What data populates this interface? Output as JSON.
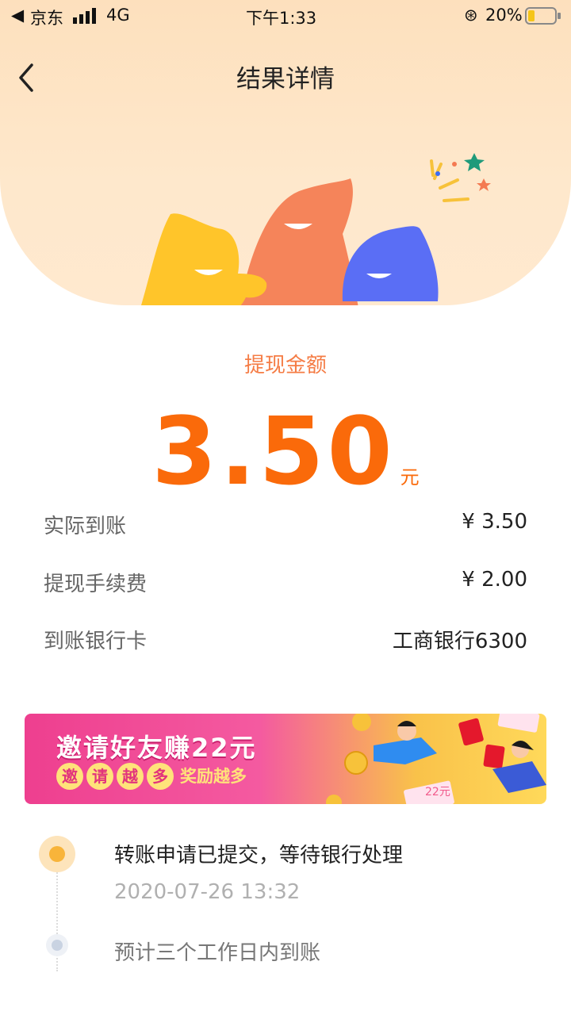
{
  "status_bar": {
    "carrier": "京东",
    "network": "4G",
    "time": "下午1:33",
    "battery": "20%"
  },
  "nav": {
    "title": "结果详情"
  },
  "amount": {
    "label": "提现金额",
    "value": "3.50",
    "unit": "元"
  },
  "details": [
    {
      "label": "实际到账",
      "value": "¥ 3.50"
    },
    {
      "label": "提现手续费",
      "value": "¥ 2.00"
    },
    {
      "label": "到账银行卡",
      "value": "工商银行6300"
    }
  ],
  "banner": {
    "title": "邀请好友赚22元",
    "pills": [
      "邀",
      "请",
      "越",
      "多"
    ],
    "sub_text": "奖励越多",
    "ticket_text": "22元"
  },
  "timeline": [
    {
      "text": "转账申请已提交，等待银行处理",
      "time": "2020-07-26 13:32"
    },
    {
      "text": "预计三个工作日内到账"
    }
  ],
  "colors": {
    "accent": "#fa6a0a",
    "label_orange": "#f57c45",
    "hero_bg": "#fde0bd",
    "timeline_active": "#f8b43a",
    "timeline_pending": "#c9d3e2"
  }
}
